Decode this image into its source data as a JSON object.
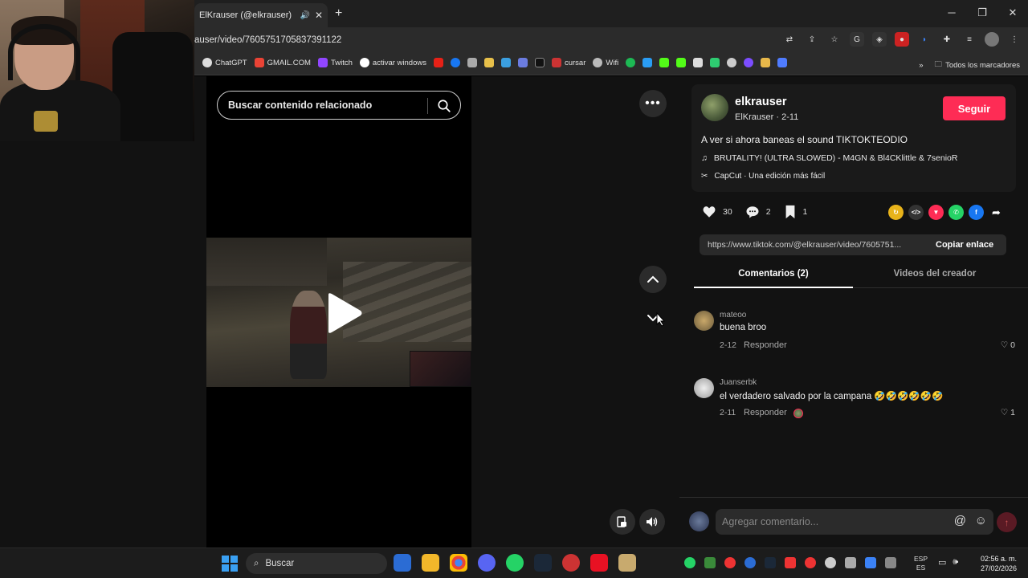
{
  "browser": {
    "tab_title": "ElKrauser (@elkrauser) | TikTok",
    "url": "auser/video/7605751705837391122",
    "bookmarks": [
      "ChatGPT",
      "GMAIL.COM",
      "Twitch",
      "activar windows",
      "cursar",
      "Wifi"
    ],
    "all_bookmarks": "Todos los marcadores"
  },
  "search": {
    "placeholder": "Buscar contenido relacionado"
  },
  "creator": {
    "username": "elkrauser",
    "display_meta": "ElKrauser · 2-11",
    "follow_label": "Seguir",
    "description": "A ver si ahora baneas el sound TIKTOKTEODIO",
    "music": "BRUTALITY! (ULTRA SLOWED) - M4GN & Bl4CKlittle & 7senioR",
    "capcut": "CapCut · Una edición más fácil"
  },
  "stats": {
    "likes": "30",
    "comments": "2",
    "saves": "1"
  },
  "link": {
    "url": "https://www.tiktok.com/@elkrauser/video/7605751...",
    "copy_label": "Copiar enlace"
  },
  "tabs": {
    "comments": "Comentarios (2)",
    "creator_videos": "Videos del creador"
  },
  "comments": [
    {
      "user": "mateoo",
      "text": "buena broo",
      "date": "2-12",
      "reply": "Responder",
      "likes": "0"
    },
    {
      "user": "Juanserbk",
      "text": "el verdadero salvado por la campana 🤣🤣🤣🤣🤣🤣",
      "date": "2-11",
      "reply": "Responder",
      "likes": "1"
    }
  ],
  "add_comment": {
    "placeholder": "Agregar comentario..."
  },
  "taskbar": {
    "search_label": "Buscar",
    "lang": "ESP",
    "lang_sub": "ES",
    "time": "02:56 a. m.",
    "date": "27/02/2026"
  },
  "colors": {
    "accent": "#fe2c55",
    "bg": "#121212"
  }
}
